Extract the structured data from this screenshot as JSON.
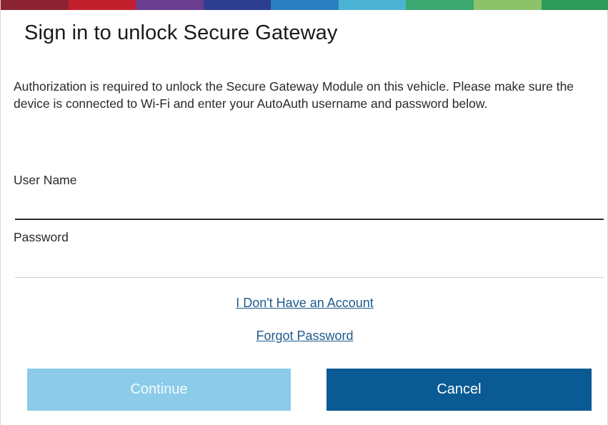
{
  "dialog": {
    "title": "Sign in to unlock Secure Gateway",
    "description": "Authorization is required to unlock the Secure Gateway Module on this vehicle. Please make sure the device is connected to Wi-Fi and enter your AutoAuth username and password below."
  },
  "form": {
    "username_label": "User Name",
    "username_value": "",
    "password_label": "Password",
    "password_value": ""
  },
  "links": {
    "no_account": "I Don't Have an Account",
    "forgot_password": "Forgot Password"
  },
  "buttons": {
    "continue_label": "Continue",
    "cancel_label": "Cancel"
  },
  "colors": {
    "continue_button": "#8ccbe9",
    "cancel_button": "#0a5a93",
    "link": "#1f5a8f",
    "top_stripe": [
      "#8b2332",
      "#c21f2d",
      "#6a3d8f",
      "#2c3e8f",
      "#2a7fc0",
      "#4cb3d4",
      "#3aa870",
      "#8cc26a",
      "#2e9a5a"
    ]
  }
}
